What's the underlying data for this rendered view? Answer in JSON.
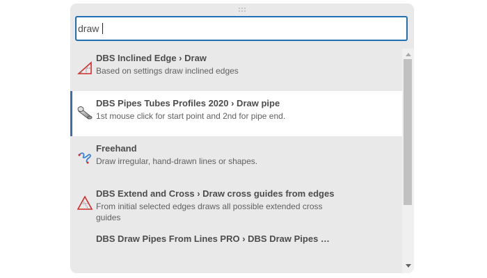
{
  "search": {
    "value": "draw"
  },
  "results": [
    {
      "title": "DBS Inclined Edge › Draw",
      "description": "Based on settings draw inclined edges",
      "icon": "inclined-edge-icon",
      "active": false
    },
    {
      "title": "DBS Pipes Tubes Profiles 2020 › Draw pipe",
      "description": "1st mouse click for start point and 2nd for pipe end.",
      "icon": "pipe-icon",
      "active": true
    },
    {
      "title": "Freehand",
      "description": "Draw irregular, hand-drawn lines or shapes.",
      "icon": "freehand-icon",
      "active": false
    },
    {
      "title": "DBS Extend and Cross › Draw cross guides from edges",
      "description": "From initial selected edges draws all possible extended cross guides",
      "icon": "cross-guides-icon",
      "active": false
    },
    {
      "title": "DBS Draw Pipes From Lines PRO › DBS Draw Pipes …",
      "description": "",
      "icon": "",
      "active": false
    }
  ],
  "colors": {
    "panel_background": "#e9e9e9",
    "active_row_background": "#ffffff",
    "focus_border": "#1f6fb2",
    "active_indicator": "#3b6fb0"
  }
}
